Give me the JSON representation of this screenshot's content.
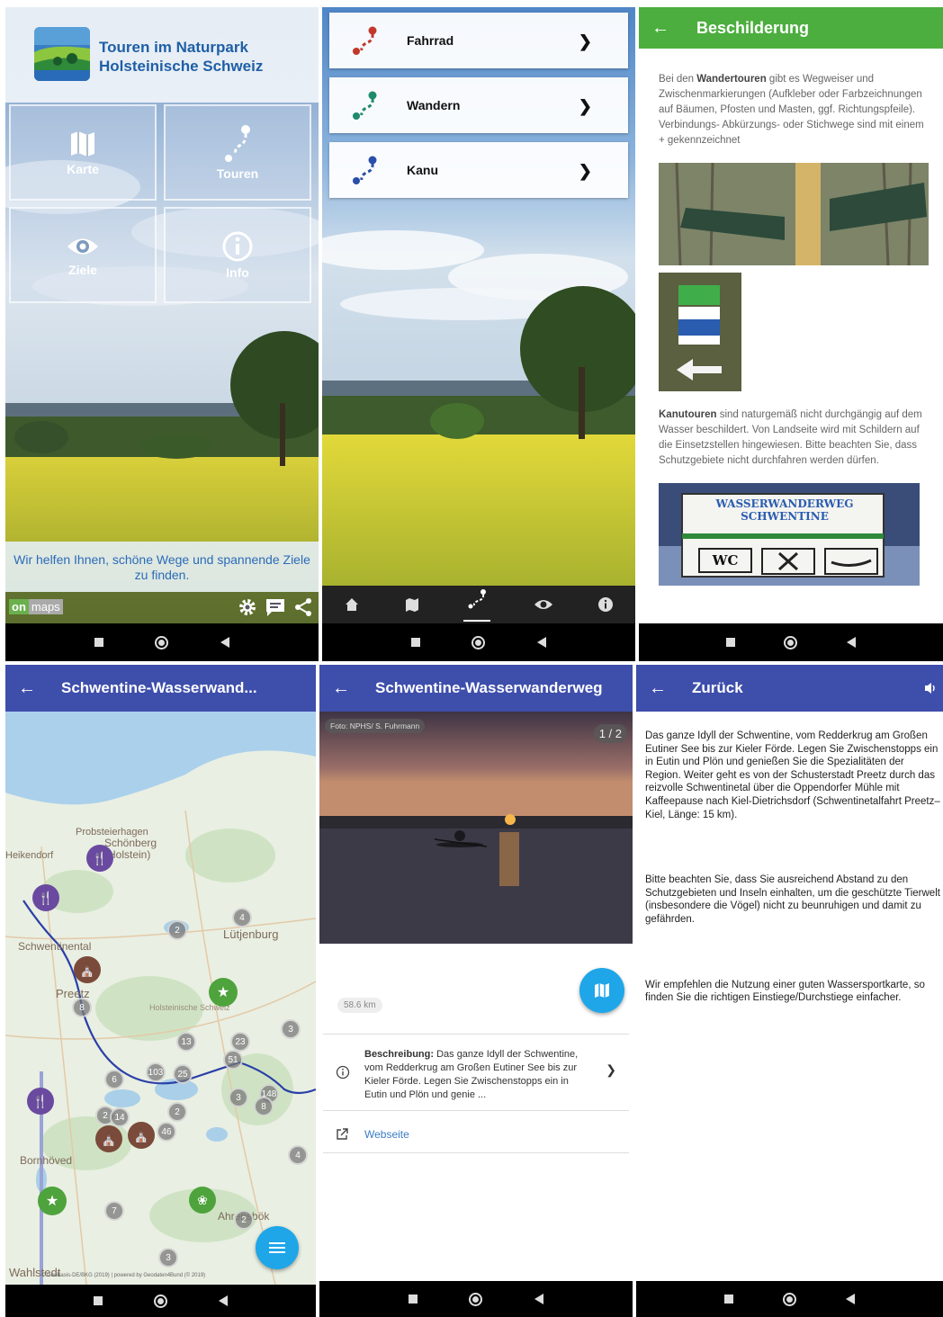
{
  "panel1": {
    "brand_line1": "Touren im Naturpark",
    "brand_line2": "Holsteinische Schweiz",
    "tiles": [
      {
        "label": "Karte",
        "icon": "map-icon"
      },
      {
        "label": "Touren",
        "icon": "route-icon"
      },
      {
        "label": "Ziele",
        "icon": "eye-icon"
      },
      {
        "label": "Info",
        "icon": "info-icon"
      }
    ],
    "tagline": "Wir helfen Ihnen, schöne Wege und spannende Ziele zu finden.",
    "onmaps_on": "on",
    "onmaps_maps": "maps"
  },
  "panel2": {
    "menu": [
      {
        "label": "Fahrrad",
        "color": "#c0392b"
      },
      {
        "label": "Wandern",
        "color": "#1e8a6e"
      },
      {
        "label": "Kanu",
        "color": "#2a4fa8"
      }
    ]
  },
  "panel3": {
    "title": "Beschilderung",
    "para1_bold": "Wandertouren",
    "para1_pre": "Bei den ",
    "para1_post": " gibt es Wegweiser und Zwischenmarkierungen (Aufkleber oder Farbzeichnungen auf Bäumen, Pfosten und Masten, ggf. Richtungspfeile). Verbindungs- Abkürzungs- oder Stichwege sind mit einem + gekennzeichnet",
    "para2_bold": "Kanutouren",
    "para2_post": " sind naturgemäß nicht durchgängig auf dem Wasser beschildert. Von Landseite wird mit Schildern auf die Einsetzstellen hingewiesen. Bitte beachten Sie, dass Schutzgebiete nicht durchfahren werden dürfen.",
    "sign_line1": "WASSERWANDERWEG",
    "sign_line2": "SCHWENTINE",
    "sign_wc": "WC"
  },
  "panel4": {
    "title": "Schwentine-Wasserwand...",
    "places": [
      "Schönberg (Holstein)",
      "Probsteierhagen",
      "Heikendorf",
      "Schwentinental",
      "Lütjenburg",
      "Preetz",
      "Holsteinische Schweiz",
      "Bornhöved",
      "Wahlstedt",
      "Ahrensbök"
    ],
    "clusters": [
      "2",
      "4",
      "8",
      "3",
      "13",
      "23",
      "51",
      "103",
      "25",
      "148",
      "6",
      "8",
      "2",
      "14",
      "3",
      "46",
      "2",
      "4",
      "7",
      "2",
      "3"
    ],
    "attribution": "© GeoBasis-DE/BKG (2019) | powered by Geodaten4Bund (© 2019)"
  },
  "panel5": {
    "title": "Schwentine-Wasserwanderweg",
    "photo_credit": "Foto: NPHS/ S. Fuhrmann",
    "pager": "1 / 2",
    "distance": "58.6 km",
    "desc_label": "Beschreibung:",
    "desc_text": " Das ganze Idyll der Schwentine, vom Redderkrug am Großen Eutiner See bis zur Kieler Förde. Legen Sie Zwischenstopps ein in Eutin und Plön und genie ...",
    "website_label": "Webseite"
  },
  "panel6": {
    "title": "Zurück",
    "paragraphs": [
      "Das ganze Idyll der Schwentine, vom Redderkrug am Großen Eutiner See bis zur Kieler Förde. Legen Sie Zwischenstopps ein in Eutin und Plön und genießen Sie die Spezialitäten der Region. Weiter geht es von der Schusterstadt Preetz durch das reizvolle Schwentinetal über die Oppendorfer Mühle mit Kaffeepause nach Kiel-Dietrichsdorf (Schwentinetalfahrt Preetz–Kiel, Länge: 15 km).",
      "Bitte beachten Sie, dass Sie ausreichend Abstand zu den Schutzgebieten und Inseln einhalten, um die geschützte Tierwelt (insbesondere die Vögel) nicht zu beunruhigen und damit zu gefährden.",
      "Wir empfehlen die Nutzung einer guten Wassersportkarte, so finden Sie die richtigen Einstiege/Durchstiege einfacher."
    ]
  },
  "colors": {
    "green_appbar": "#4cae3e",
    "indigo_appbar": "#3e4eab",
    "fab_blue": "#1ea6e8",
    "brand_blue": "#1f5fa6"
  }
}
